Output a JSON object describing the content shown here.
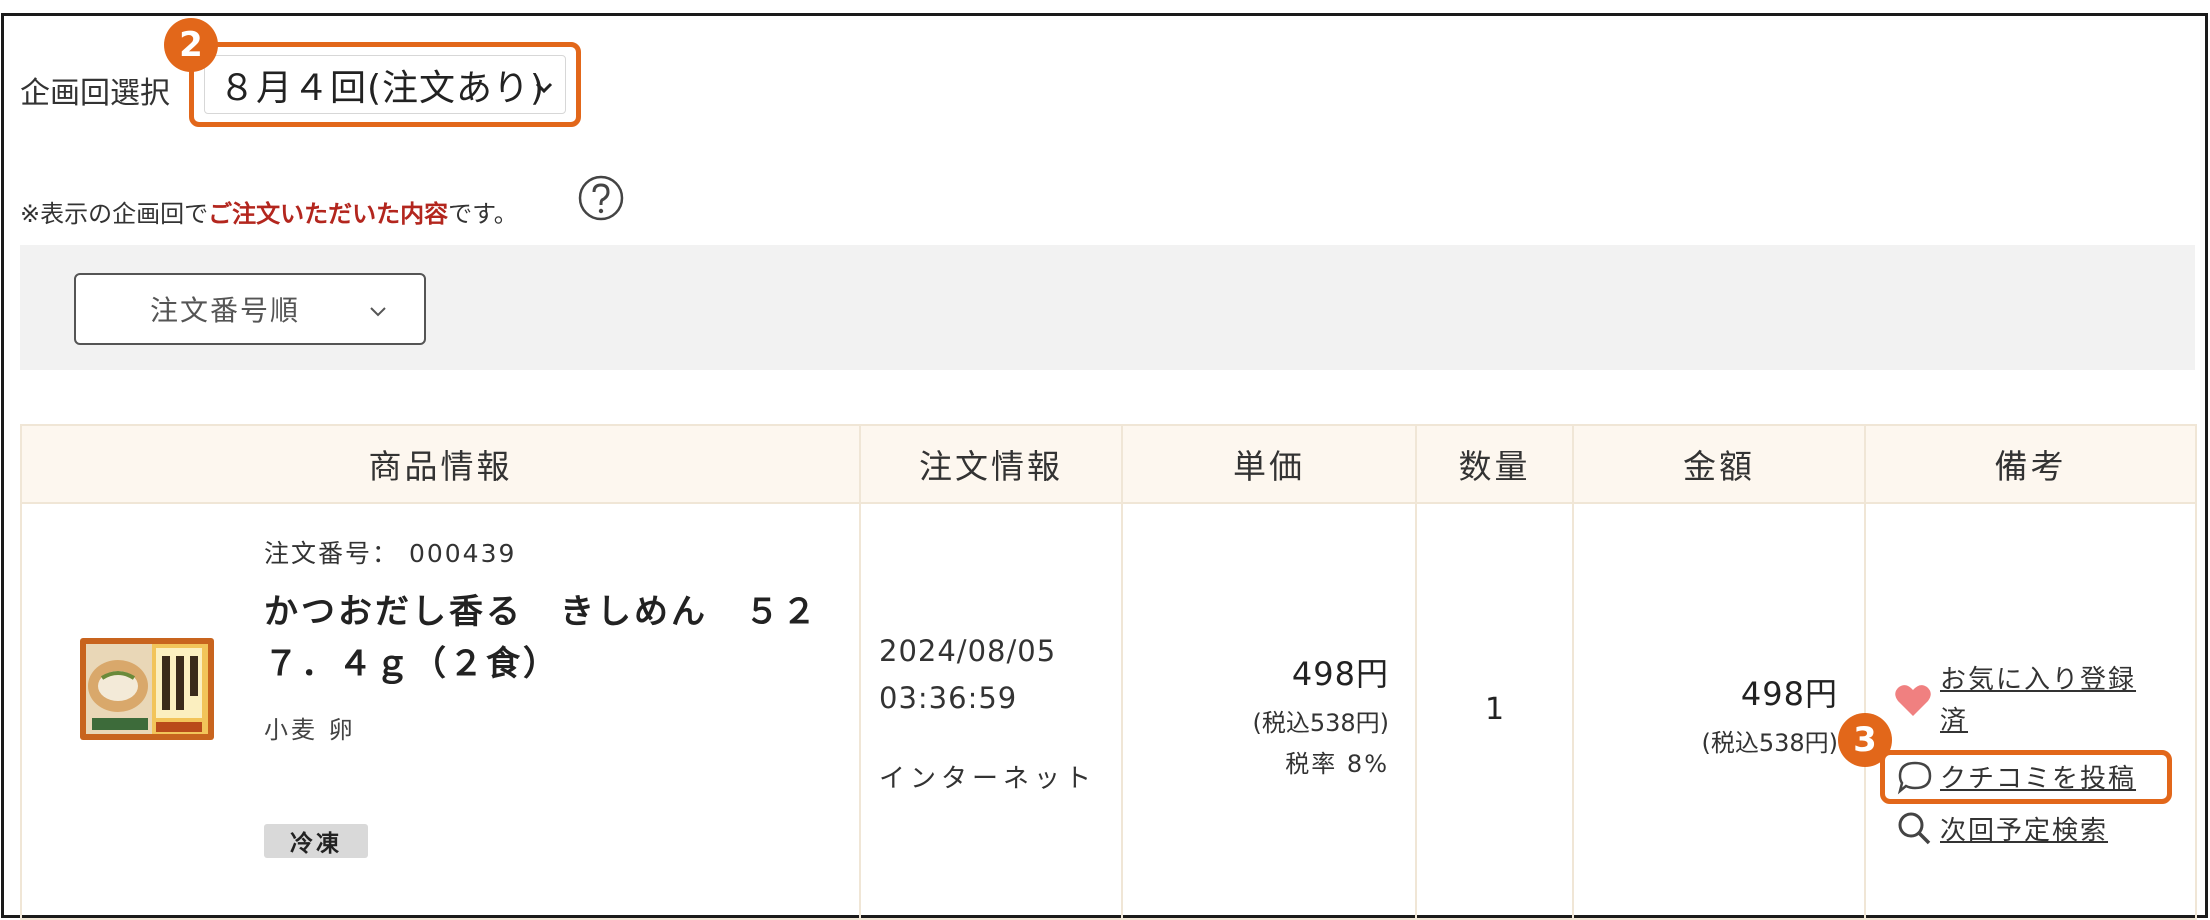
{
  "session": {
    "label": "企画回選択",
    "selected": "８月４回(注文あり)",
    "step_badge": "2"
  },
  "note": {
    "prefix": "※表示の企画回で",
    "emphasis": "ご注文いただいた内容",
    "suffix": "です。"
  },
  "sort": {
    "selected": "注文番号順"
  },
  "table": {
    "headers": [
      "商品情報",
      "注文情報",
      "単価",
      "数量",
      "金額",
      "備考"
    ],
    "rows": [
      {
        "order_number": "注文番号： 000439",
        "product_name": "かつおだし香る　きしめん　５２７．４ｇ（２食）",
        "allergens": "小麦 卵",
        "storage_tag": "冷凍",
        "order_date": "2024/08/05",
        "order_time": "03:36:59",
        "channel": "インターネット",
        "unit_price": "498円",
        "unit_price_tax": "(税込538円)",
        "tax_rate": "税率 8%",
        "quantity": "1",
        "amount": "498円",
        "amount_tax": "(税込538円)",
        "remarks": {
          "favorite_line1": "お気に入り登録",
          "favorite_line2": "済",
          "review": "クチコミを投稿",
          "next_search": "次回予定検索",
          "step_badge": "3"
        }
      }
    ]
  },
  "colors": {
    "highlight": "#e2671a",
    "emphasis_text": "#b3261e",
    "heart": "#f08080",
    "header_bg": "#fdf7ef"
  }
}
